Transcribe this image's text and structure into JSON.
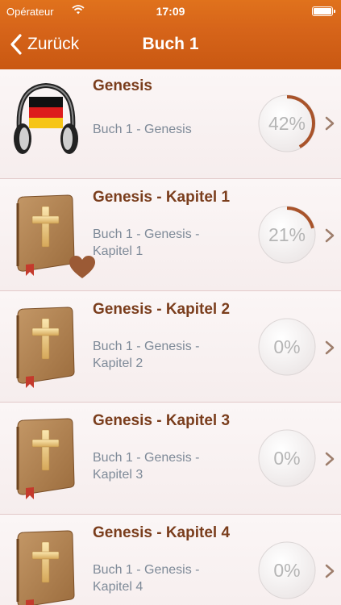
{
  "status_bar": {
    "carrier": "Opérateur",
    "time": "17:09"
  },
  "nav": {
    "back_label": "Zurück",
    "title": "Buch 1"
  },
  "items": [
    {
      "title": "Genesis",
      "subtitle_line1": "Buch 1 - Genesis",
      "subtitle_line2": "",
      "progress_label": "42%",
      "progress": 0.42,
      "icon": "headphones-germany-flag-icon",
      "favorite": false
    },
    {
      "title": "Genesis - Kapitel 1",
      "subtitle_line1": "Buch 1 - Genesis -",
      "subtitle_line2": "Kapitel 1",
      "progress_label": "21%",
      "progress": 0.21,
      "icon": "bible-book-icon",
      "favorite": true
    },
    {
      "title": "Genesis - Kapitel 2",
      "subtitle_line1": "Buch 1 - Genesis -",
      "subtitle_line2": "Kapitel 2",
      "progress_label": "0%",
      "progress": 0,
      "icon": "bible-book-icon",
      "favorite": false
    },
    {
      "title": "Genesis - Kapitel 3",
      "subtitle_line1": "Buch 1 - Genesis -",
      "subtitle_line2": "Kapitel 3",
      "progress_label": "0%",
      "progress": 0,
      "icon": "bible-book-icon",
      "favorite": false
    },
    {
      "title": "Genesis - Kapitel 4",
      "subtitle_line1": "Buch 1 - Genesis -",
      "subtitle_line2": "Kapitel 4",
      "progress_label": "0%",
      "progress": 0,
      "icon": "bible-book-icon",
      "favorite": false
    }
  ],
  "colors": {
    "header": "#d7651a",
    "title_text": "#7a3d1c",
    "subtitle_text": "#7e8a98",
    "progress_arc": "#a9532a",
    "chevron": "#9e7e6c"
  }
}
